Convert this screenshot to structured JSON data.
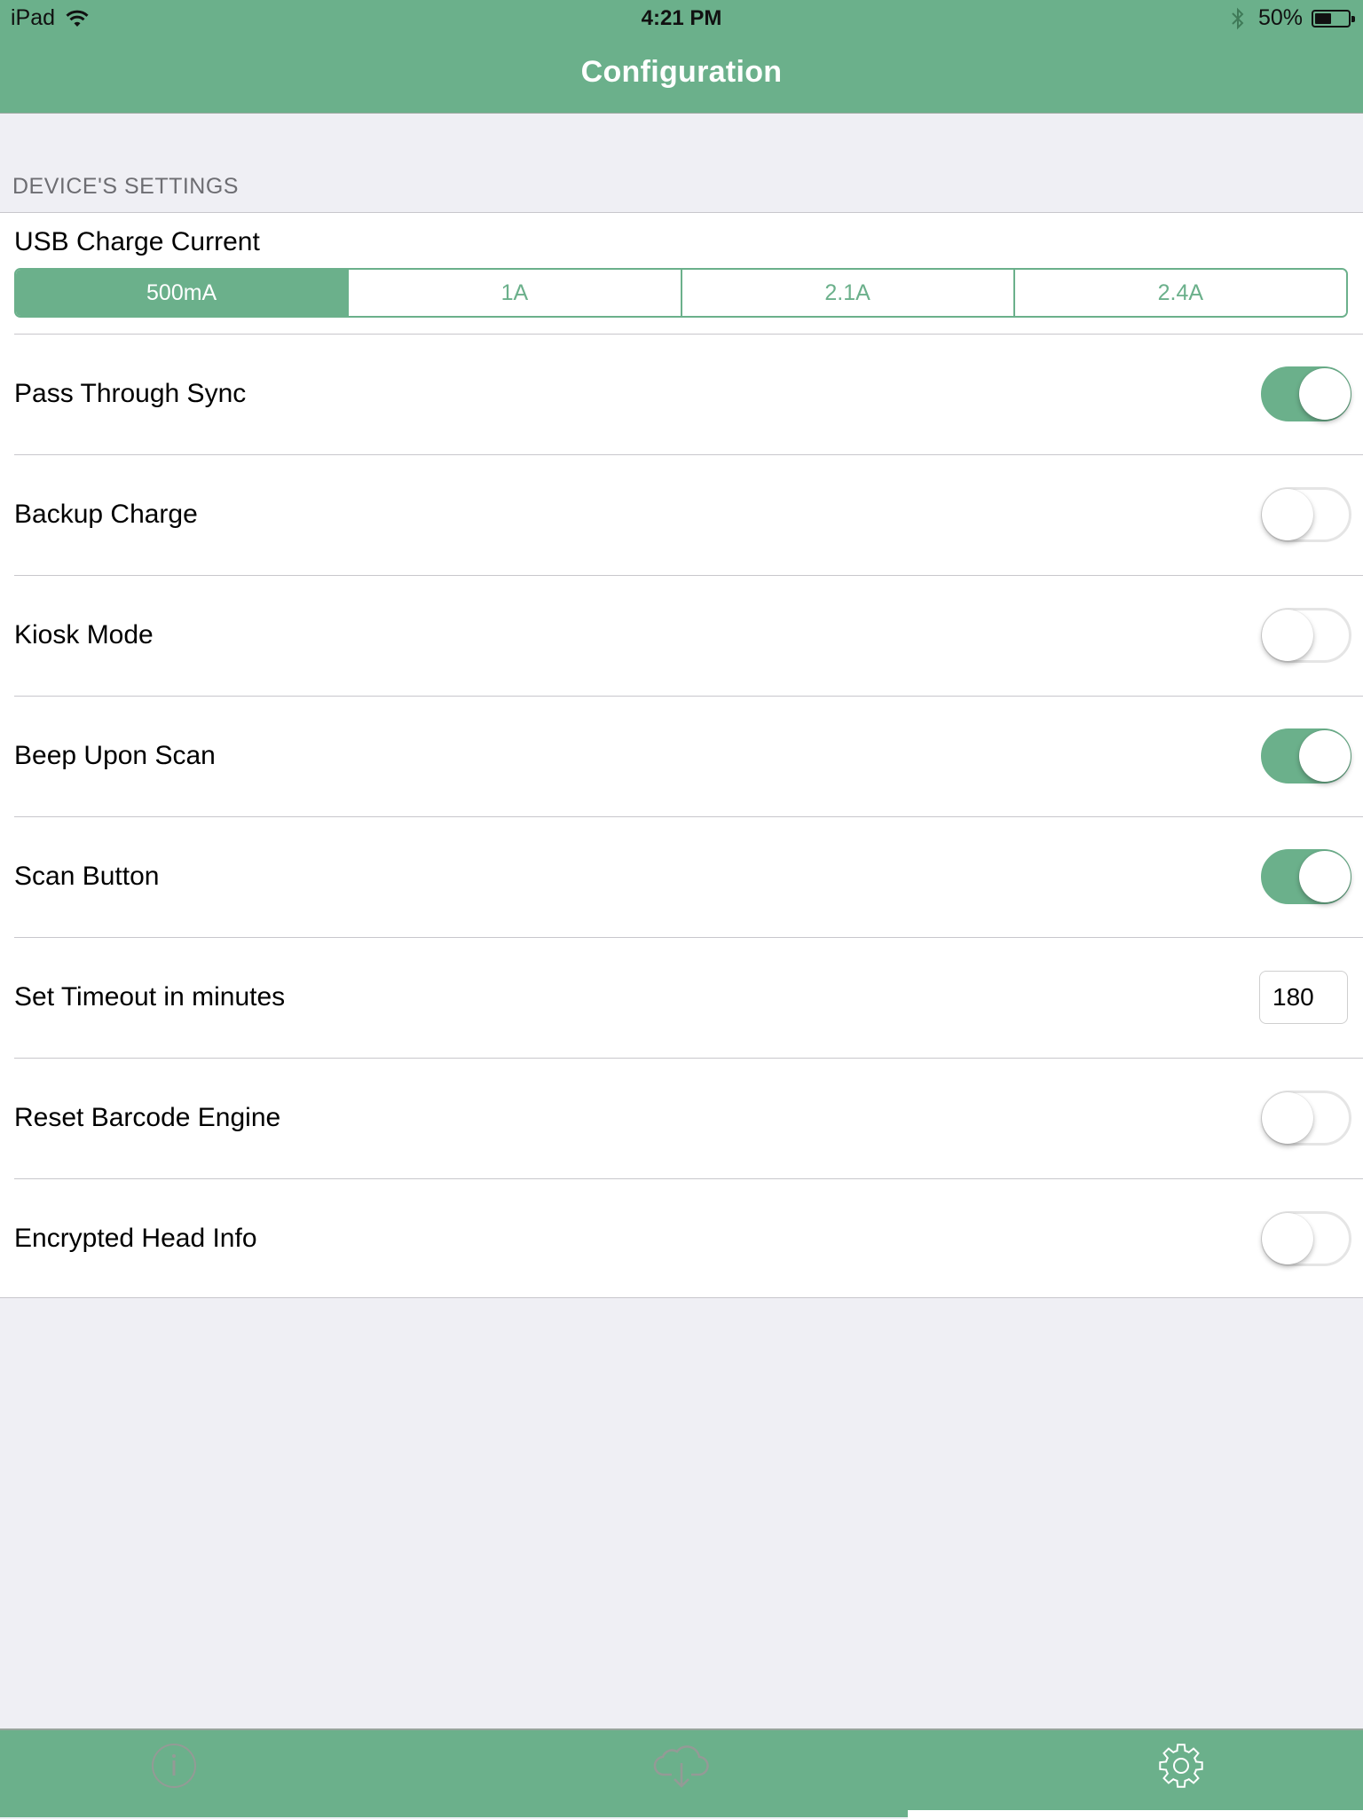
{
  "status_bar": {
    "carrier": "iPad",
    "time": "4:21 PM",
    "battery_percent_label": "50%",
    "battery_level": 0.5,
    "icons": [
      "wifi-icon",
      "bluetooth-icon",
      "battery-icon"
    ]
  },
  "nav": {
    "title": "Configuration"
  },
  "colors": {
    "accent": "#6bb08b",
    "background": "#efeff4",
    "section_text": "#6d6d72",
    "separator": "#c8c7cc",
    "inactive_tab_icon": "#949a96"
  },
  "section": {
    "header": "DEVICE'S SETTINGS"
  },
  "usb_charge": {
    "label": "USB Charge Current",
    "options": [
      "500mA",
      "1A",
      "2.1A",
      "2.4A"
    ],
    "selected": "500mA"
  },
  "settings": [
    {
      "label": "Pass Through Sync",
      "type": "toggle",
      "on": true
    },
    {
      "label": "Backup Charge",
      "type": "toggle",
      "on": false
    },
    {
      "label": "Kiosk Mode",
      "type": "toggle",
      "on": false
    },
    {
      "label": "Beep Upon Scan",
      "type": "toggle",
      "on": true
    },
    {
      "label": "Scan Button",
      "type": "toggle",
      "on": true
    },
    {
      "label": "Set Timeout in minutes",
      "type": "text",
      "value": "180"
    },
    {
      "label": "Reset Barcode Engine",
      "type": "toggle",
      "on": false
    },
    {
      "label": "Encrypted Head Info",
      "type": "toggle",
      "on": false
    }
  ],
  "tab_bar": {
    "tabs": [
      {
        "icon": "info-icon",
        "selected": false
      },
      {
        "icon": "cloud-download-icon",
        "selected": false
      },
      {
        "icon": "gear-icon",
        "selected": true
      }
    ]
  }
}
